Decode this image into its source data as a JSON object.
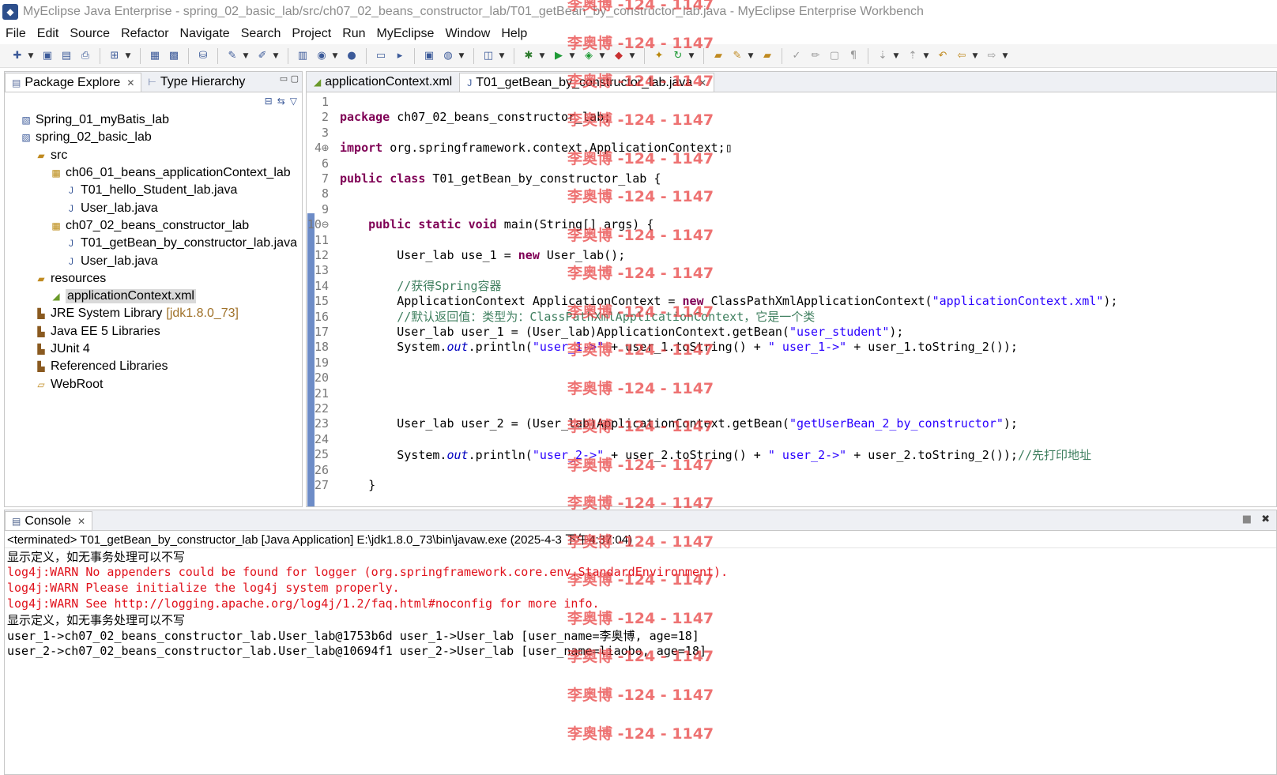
{
  "window": {
    "title": "MyEclipse Java Enterprise - spring_02_basic_lab/src/ch07_02_beans_constructor_lab/T01_getBean_by_constructor_lab.java - MyEclipse Enterprise Workbench"
  },
  "menu": [
    "File",
    "Edit",
    "Source",
    "Refactor",
    "Navigate",
    "Search",
    "Project",
    "Run",
    "MyEclipse",
    "Window",
    "Help"
  ],
  "left_panel": {
    "tabs": [
      {
        "label": "Package Explore",
        "active": true
      },
      {
        "label": "Type Hierarchy",
        "active": false
      }
    ],
    "tree": [
      {
        "label": "Spring_01_myBatis_lab",
        "indent": 0,
        "icon": "project-icon"
      },
      {
        "label": "spring_02_basic_lab",
        "indent": 0,
        "icon": "project-icon"
      },
      {
        "label": "src",
        "indent": 1,
        "icon": "source-folder-icon"
      },
      {
        "label": "ch06_01_beans_applicationContext_lab",
        "indent": 2,
        "icon": "package-icon"
      },
      {
        "label": "T01_hello_Student_lab.java",
        "indent": 3,
        "icon": "java-file-icon"
      },
      {
        "label": "User_lab.java",
        "indent": 3,
        "icon": "java-file-icon"
      },
      {
        "label": "ch07_02_beans_constructor_lab",
        "indent": 2,
        "icon": "package-icon"
      },
      {
        "label": "T01_getBean_by_constructor_lab.java",
        "indent": 3,
        "icon": "java-file-icon"
      },
      {
        "label": "User_lab.java",
        "indent": 3,
        "icon": "java-file-icon"
      },
      {
        "label": "resources",
        "indent": 1,
        "icon": "source-folder-icon"
      },
      {
        "label": "applicationContext.xml",
        "indent": 2,
        "icon": "xml-file-icon",
        "selected": true
      },
      {
        "label": "JRE System Library",
        "suffix": "[jdk1.8.0_73]",
        "indent": 1,
        "icon": "library-icon"
      },
      {
        "label": "Java EE 5 Libraries",
        "indent": 1,
        "icon": "library-icon"
      },
      {
        "label": "JUnit 4",
        "indent": 1,
        "icon": "library-icon"
      },
      {
        "label": "Referenced Libraries",
        "indent": 1,
        "icon": "library-icon"
      },
      {
        "label": "WebRoot",
        "indent": 1,
        "icon": "folder-icon"
      }
    ]
  },
  "editor": {
    "tabs": [
      {
        "label": "applicationContext.xml",
        "active": false
      },
      {
        "label": "T01_getBean_by_constructor_lab.java",
        "active": true
      }
    ],
    "lines": [
      {
        "n": "1",
        "code": ""
      },
      {
        "n": "2",
        "code": "<span class='kw'>package</span> ch07_02_beans_constructor_lab;"
      },
      {
        "n": "3",
        "code": ""
      },
      {
        "n": "4⊕",
        "code": "<span class='kw'>import</span> org.springframework.context.ApplicationContext;▯"
      },
      {
        "n": "6",
        "code": ""
      },
      {
        "n": "7",
        "code": "<span class='kw'>public</span> <span class='kw'>class</span> T01_getBean_by_constructor_lab {"
      },
      {
        "n": "8",
        "code": ""
      },
      {
        "n": "9",
        "code": ""
      },
      {
        "n": "10⊖",
        "code": "    <span class='kw'>public</span> <span class='kw'>static</span> <span class='kw'>void</span> main(String[] args) {"
      },
      {
        "n": "11",
        "code": ""
      },
      {
        "n": "12",
        "code": "        User_lab use_1 = <span class='kw'>new</span> User_lab();"
      },
      {
        "n": "13",
        "code": ""
      },
      {
        "n": "14",
        "code": "        <span class='cm'>//获得Spring容器</span>"
      },
      {
        "n": "15",
        "code": "        ApplicationContext ApplicationContext = <span class='kw'>new</span> ClassPathXmlApplicationContext(<span class='str'>\"applicationContext.xml\"</span>);"
      },
      {
        "n": "16",
        "code": "        <span class='cm'>//默认返回值：类型为：ClassPathXmlApplicationContext，它是一个类</span>"
      },
      {
        "n": "17",
        "code": "        User_lab user_1 = (User_lab)ApplicationContext.getBean(<span class='str'>\"user_student\"</span>);"
      },
      {
        "n": "18",
        "code": "        System.<span class='sfield'>out</span>.println(<span class='str'>\"user_1->\"</span> + user_1.toString() + <span class='str'>\" user_1->\"</span> + user_1.toString_2());"
      },
      {
        "n": "19",
        "code": ""
      },
      {
        "n": "20",
        "code": ""
      },
      {
        "n": "21",
        "code": ""
      },
      {
        "n": "22",
        "code": ""
      },
      {
        "n": "23",
        "code": "        User_lab user_2 = (User_lab)ApplicationContext.getBean(<span class='str'>\"getUserBean_2_by_constructor\"</span>);"
      },
      {
        "n": "24",
        "code": ""
      },
      {
        "n": "25",
        "code": "        System.<span class='sfield'>out</span>.println(<span class='str'>\"user_2->\"</span> + user_2.toString() + <span class='str'>\" user_2->\"</span> + user_2.toString_2());<span class='cm'>//先打印地址</span>"
      },
      {
        "n": "26",
        "code": ""
      },
      {
        "n": "27",
        "code": "    }"
      }
    ]
  },
  "console": {
    "tab_label": "Console",
    "status": "<terminated> T01_getBean_by_constructor_lab [Java Application] E:\\jdk1.8.0_73\\bin\\javaw.exe (2025-4-3 下午4:37:04)",
    "lines": [
      {
        "text": "显示定义，如无事务处理可以不写",
        "type": "out"
      },
      {
        "text": "log4j:WARN No appenders could be found for logger (org.springframework.core.env.StandardEnvironment).",
        "type": "err"
      },
      {
        "text": "log4j:WARN Please initialize the log4j system properly.",
        "type": "err"
      },
      {
        "text": "log4j:WARN See http://logging.apache.org/log4j/1.2/faq.html#noconfig for more info.",
        "type": "err"
      },
      {
        "text": "显示定义，如无事务处理可以不写",
        "type": "out"
      },
      {
        "text": "user_1->ch07_02_beans_constructor_lab.User_lab@1753b6d user_1->User_lab [user_name=李奥博, age=18]",
        "type": "out"
      },
      {
        "text": "user_2->ch07_02_beans_constructor_lab.User_lab@10694f1 user_2->User_lab [user_name=liaobo, age=18]",
        "type": "out"
      }
    ]
  },
  "watermark": {
    "text": "李奥博 -124 - 1147"
  },
  "colors": {
    "keyword": "#7f0055",
    "string": "#2a00ff",
    "comment": "#3f7f5f",
    "error": "#e0111b",
    "watermark": "#e83c3c"
  }
}
